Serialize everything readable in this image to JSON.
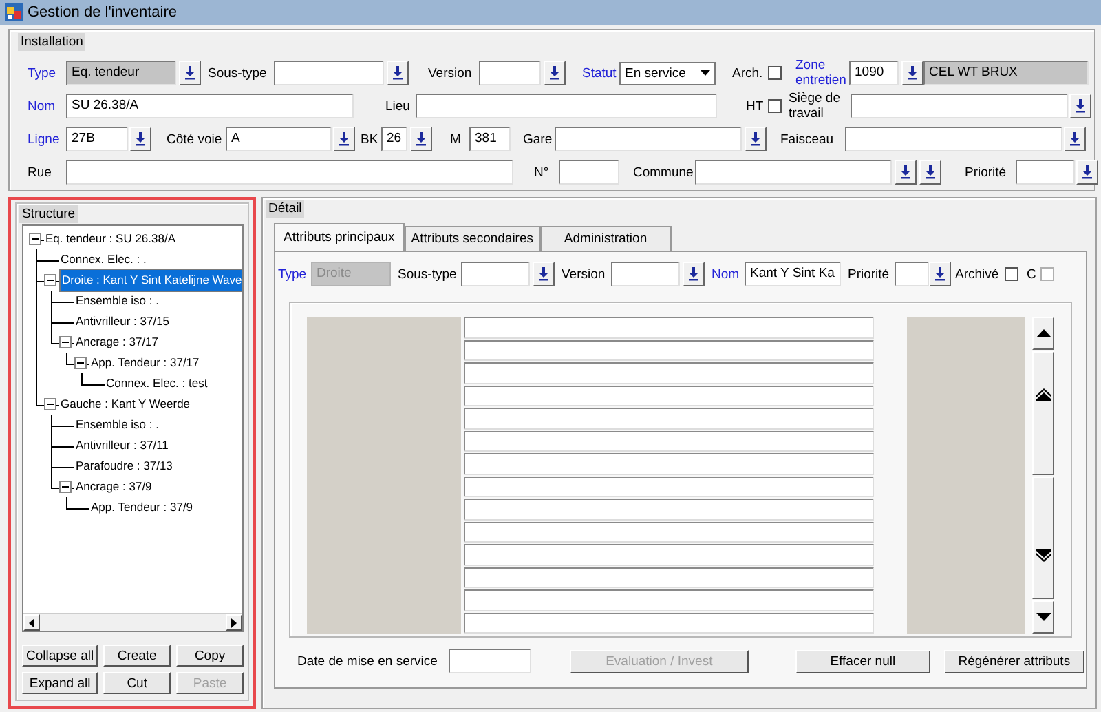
{
  "window": {
    "title": "Gestion de l'inventaire"
  },
  "installation": {
    "title": "Installation",
    "rows": [
      {
        "items": [
          {
            "kind": "label",
            "text": "Type",
            "required": true
          },
          {
            "kind": "field",
            "value": "Eq. tendeur",
            "readonly": true
          },
          {
            "kind": "button"
          },
          {
            "kind": "label",
            "text": "Sous-type",
            "required": false
          },
          {
            "kind": "field",
            "readonly": false
          },
          {
            "kind": "button"
          },
          {
            "kind": "label",
            "text": "Version",
            "required": false
          },
          {
            "kind": "field",
            "readonly": false
          },
          {
            "kind": "button"
          },
          {
            "kind": "label",
            "text": "Statut",
            "required": true
          },
          {
            "kind": "select",
            "value": "En service"
          },
          {
            "kind": "label",
            "text": "Arch.",
            "required": false
          },
          {
            "kind": "checkbox",
            "checked": false
          },
          {
            "kind": "label",
            "text": "Zone entretien",
            "required": true
          },
          {
            "kind": "field",
            "value": "1090",
            "readonly": false
          },
          {
            "kind": "button"
          },
          {
            "kind": "field",
            "value": "CEL WT BRUX",
            "readonly": true
          }
        ]
      },
      {
        "items": [
          {
            "kind": "label",
            "text": "Nom",
            "required": true
          },
          {
            "kind": "field",
            "value": "SU 26.38/A",
            "readonly": false
          },
          {
            "kind": "label",
            "text": "Lieu",
            "required": false
          },
          {
            "kind": "field",
            "readonly": false
          },
          {
            "kind": "label",
            "text": "HT",
            "required": false
          },
          {
            "kind": "checkbox",
            "checked": false
          },
          {
            "kind": "label",
            "text": "Siège de travail",
            "required": false
          },
          {
            "kind": "field",
            "readonly": false
          },
          {
            "kind": "button"
          }
        ]
      },
      {
        "items": [
          {
            "kind": "label",
            "text": "Ligne",
            "required": true
          },
          {
            "kind": "field",
            "value": "27B",
            "readonly": false
          },
          {
            "kind": "button"
          },
          {
            "kind": "label",
            "text": "Côté voie",
            "required": false
          },
          {
            "kind": "field",
            "value": "A",
            "readonly": false
          },
          {
            "kind": "button"
          },
          {
            "kind": "label",
            "text": "BK",
            "required": false
          },
          {
            "kind": "field",
            "value": "26",
            "readonly": false
          },
          {
            "kind": "button"
          },
          {
            "kind": "label",
            "text": "M",
            "required": false
          },
          {
            "kind": "field",
            "value": "381",
            "readonly": false
          },
          {
            "kind": "label",
            "text": "Gare",
            "required": false
          },
          {
            "kind": "field",
            "readonly": false
          },
          {
            "kind": "button"
          },
          {
            "kind": "label",
            "text": "Faisceau",
            "required": false
          },
          {
            "kind": "field",
            "readonly": false
          },
          {
            "kind": "button"
          }
        ]
      },
      {
        "items": [
          {
            "kind": "label",
            "text": "Rue",
            "required": false
          },
          {
            "kind": "field",
            "readonly": false
          },
          {
            "kind": "label",
            "text": "N°",
            "required": false
          },
          {
            "kind": "field",
            "readonly": false
          },
          {
            "kind": "label",
            "text": "Commune",
            "required": false
          },
          {
            "kind": "field",
            "readonly": false
          },
          {
            "kind": "button"
          },
          {
            "kind": "button"
          },
          {
            "kind": "label",
            "text": "Priorité",
            "required": false
          },
          {
            "kind": "field",
            "readonly": false
          },
          {
            "kind": "button"
          }
        ]
      }
    ]
  },
  "structure": {
    "title": "Structure",
    "tree": [
      {
        "label": "Eq. tendeur : SU 26.38/A",
        "selected": false,
        "expanded": true,
        "children": [
          {
            "label": "Connex. Elec. : .",
            "selected": false
          },
          {
            "label": "Droite : Kant Y Sint Katelijne Wave",
            "selected": true,
            "expanded": true,
            "children": [
              {
                "label": "Ensemble iso : .",
                "selected": false
              },
              {
                "label": "Antivrilleur : 37/15",
                "selected": false
              },
              {
                "label": "Ancrage : 37/17",
                "selected": false,
                "expanded": true,
                "children": [
                  {
                    "label": "App. Tendeur : 37/17",
                    "selected": false,
                    "expanded": true,
                    "children": [
                      {
                        "label": "Connex. Elec. : test",
                        "selected": false
                      }
                    ]
                  }
                ]
              }
            ]
          },
          {
            "label": "Gauche : Kant Y Weerde",
            "selected": false,
            "expanded": true,
            "children": [
              {
                "label": "Ensemble iso : .",
                "selected": false
              },
              {
                "label": "Antivrilleur : 37/11",
                "selected": false
              },
              {
                "label": "Parafoudre : 37/13",
                "selected": false
              },
              {
                "label": "Ancrage : 37/9",
                "selected": false,
                "expanded": true,
                "children": [
                  {
                    "label": "App. Tendeur : 37/9",
                    "selected": false
                  }
                ]
              }
            ]
          }
        ]
      }
    ],
    "buttons": [
      {
        "label": "Collapse all",
        "disabled": false
      },
      {
        "label": "Create",
        "disabled": false
      },
      {
        "label": "Copy",
        "disabled": false
      },
      {
        "label": "Expand all",
        "disabled": false
      },
      {
        "label": "Cut",
        "disabled": false
      },
      {
        "label": "Paste",
        "disabled": true
      }
    ]
  },
  "detail": {
    "title": "Détail",
    "tabs": [
      {
        "label": "Attributs principaux",
        "selected": true
      },
      {
        "label": "Attributs secondaires",
        "selected": false
      },
      {
        "label": "Administration",
        "selected": false
      }
    ],
    "items": [
      {
        "kind": "label",
        "text": "Type",
        "required": true
      },
      {
        "kind": "field",
        "value": "Droite",
        "readonly": true,
        "disabled": true
      },
      {
        "kind": "label",
        "text": "Sous-type",
        "required": false
      },
      {
        "kind": "field",
        "readonly": false,
        "disabled": false
      },
      {
        "kind": "button"
      },
      {
        "kind": "label",
        "text": "Version",
        "required": false
      },
      {
        "kind": "field",
        "readonly": false,
        "disabled": false
      },
      {
        "kind": "button"
      },
      {
        "kind": "label",
        "text": "Nom",
        "required": true
      },
      {
        "kind": "field",
        "value": "Kant Y Sint Ka",
        "readonly": false,
        "disabled": false
      },
      {
        "kind": "label",
        "text": "Priorité",
        "required": false
      },
      {
        "kind": "field",
        "readonly": false,
        "disabled": false
      },
      {
        "kind": "button"
      },
      {
        "kind": "label",
        "text": "Archivé",
        "required": false
      },
      {
        "kind": "checkbox",
        "checked": false,
        "disabled": false
      },
      {
        "kind": "label",
        "text": "C",
        "required": false
      },
      {
        "kind": "checkbox",
        "checked": false,
        "disabled": true
      }
    ],
    "date_label": "Date de mise en service",
    "buttons": [
      {
        "label": "Evaluation / Invest",
        "disabled": true
      },
      {
        "label": "Effacer null",
        "disabled": false
      },
      {
        "label": "Régénérer attributs",
        "disabled": false
      }
    ]
  }
}
